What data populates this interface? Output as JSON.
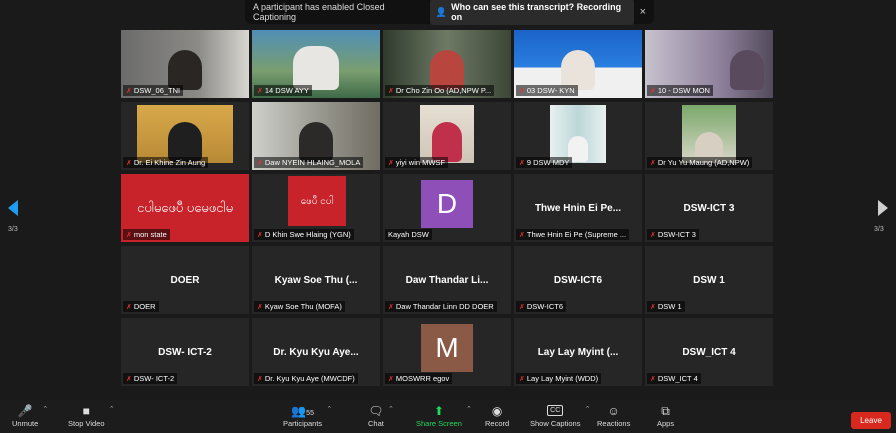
{
  "banner": {
    "notice": "A participant has enabled Closed Captioning",
    "who_button": "Who can see this transcript? Recording on",
    "close": "×"
  },
  "pages": {
    "left": "3/3",
    "right": "3/3"
  },
  "tiles": [
    {
      "label": "DSW_06_TNI",
      "title": "",
      "kind": "video"
    },
    {
      "label": "14 DSW AYY",
      "title": "",
      "kind": "video"
    },
    {
      "label": "Dr Cho Zin Oo (AD,NPW P...",
      "title": "",
      "kind": "video"
    },
    {
      "label": "03 DSW- KYN",
      "title": "",
      "kind": "video"
    },
    {
      "label": "10 - DSW MON",
      "title": "",
      "kind": "video"
    },
    {
      "label": "Dr. Ei Khine Zin Aung",
      "title": "",
      "kind": "video"
    },
    {
      "label": "Daw NYEIN HLAING_MOLA",
      "title": "",
      "kind": "video"
    },
    {
      "label": "yiyi win MWSF",
      "title": "",
      "kind": "video"
    },
    {
      "label": "9 DSW MDY",
      "title": "",
      "kind": "video"
    },
    {
      "label": "Dr Yu Yu Maung (AD,NPW)",
      "title": "",
      "kind": "video"
    },
    {
      "label": "mon state",
      "title": "",
      "kind": "image"
    },
    {
      "label": "D Khin Swe Hlaing (YGN)",
      "title": "",
      "kind": "image"
    },
    {
      "label": "Kayah DSW",
      "title": "D",
      "kind": "avatar"
    },
    {
      "label": "Thwe Hnin Ei Pe (Supreme ...",
      "title": "Thwe Hnin Ei Pe...",
      "kind": "name"
    },
    {
      "label": "DSW-ICT 3",
      "title": "DSW-ICT 3",
      "kind": "name"
    },
    {
      "label": "DOER",
      "title": "DOER",
      "kind": "name"
    },
    {
      "label": "Kyaw Soe Thu (MOFA)",
      "title": "Kyaw Soe Thu (...",
      "kind": "name"
    },
    {
      "label": "Daw Thandar Linn DD DOER",
      "title": "Daw Thandar Li...",
      "kind": "name"
    },
    {
      "label": "DSW-ICT6",
      "title": "DSW-ICT6",
      "kind": "name"
    },
    {
      "label": "DSW 1",
      "title": "DSW 1",
      "kind": "name"
    },
    {
      "label": "DSW- ICT-2",
      "title": "DSW- ICT-2",
      "kind": "name"
    },
    {
      "label": "Dr. Kyu Kyu Aye (MWCDF)",
      "title": "Dr. Kyu Kyu Aye...",
      "kind": "name"
    },
    {
      "label": "MOSWRR egov",
      "title": "M",
      "kind": "avatar"
    },
    {
      "label": "Lay Lay Myint (WDD)",
      "title": "Lay Lay Myint (...",
      "kind": "name"
    },
    {
      "label": "DSW_ICT 4",
      "title": "DSW_ICT 4",
      "kind": "name"
    }
  ],
  "toolbar": {
    "unmute": "Unmute",
    "stop_video": "Stop Video",
    "participants": "Participants",
    "participants_count": "55",
    "chat": "Chat",
    "share_screen": "Share Screen",
    "record": "Record",
    "show_captions": "Show Captions",
    "captions_badge": "CC",
    "reactions": "Reactions",
    "apps": "Apps",
    "leave": "Leave"
  },
  "colors": {
    "accent_blue": "#1e9df3",
    "share_green": "#23d959",
    "leave_red": "#d9291f",
    "mic_muted_red": "#e0332f",
    "banner_red_tile": "#c8222a",
    "avatar_purple": "#8e4fb8",
    "avatar_brown": "#8b5a46"
  }
}
